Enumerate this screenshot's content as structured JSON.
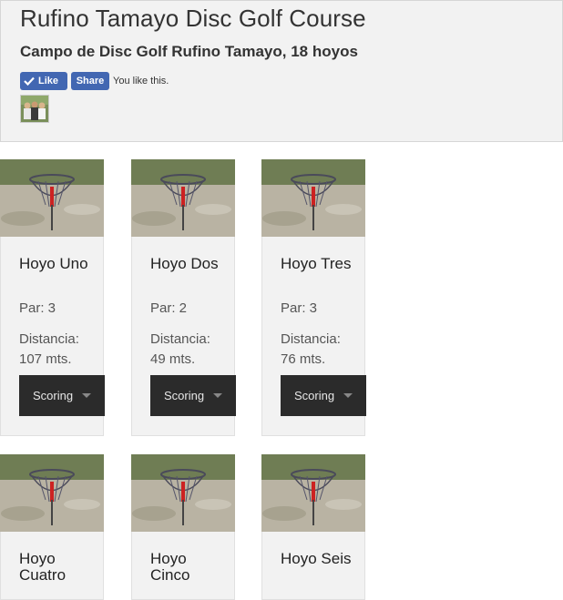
{
  "course": {
    "title": "Rufino Tamayo Disc Golf Course",
    "subtitle": "Campo de Disc Golf Rufino Tamayo, 18 hoyos"
  },
  "facebook": {
    "like_label": "Like",
    "share_label": "Share",
    "status_text": "You like this.",
    "brand_color": "#4267b2"
  },
  "holes": [
    {
      "name": "Hoyo Uno",
      "par": "Par: 3",
      "distance": "Distancia: 107 mts.",
      "scoring_label": "Scoring"
    },
    {
      "name": "Hoyo Dos",
      "par": "Par: 2",
      "distance": "Distancia: 49 mts.",
      "scoring_label": "Scoring"
    },
    {
      "name": "Hoyo Tres",
      "par": "Par: 3",
      "distance": "Distancia: 76 mts.",
      "scoring_label": "Scoring"
    },
    {
      "name": "Hoyo Cuatro"
    },
    {
      "name": "Hoyo Cinco"
    },
    {
      "name": "Hoyo Seis"
    }
  ],
  "icons": {
    "like": "thumbs-up-check-icon",
    "scoring_dropdown": "chevron-down-icon",
    "hole_photo": "disc-golf-basket-photo"
  }
}
